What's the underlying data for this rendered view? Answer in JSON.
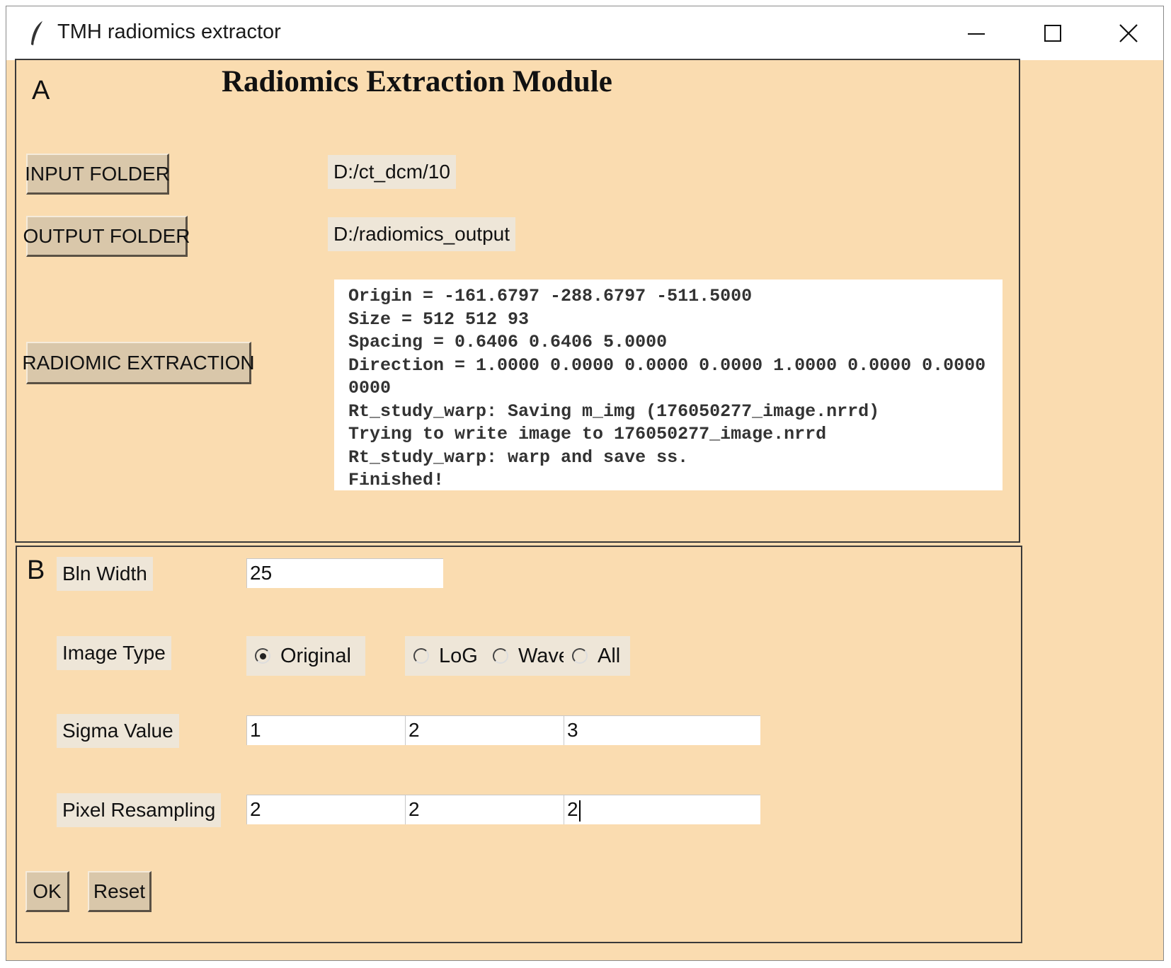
{
  "window": {
    "title": "TMH radiomics extractor",
    "icon": "feather-icon",
    "controls": [
      "minimize-icon",
      "maximize-icon",
      "close-icon"
    ]
  },
  "section_a": {
    "letter": "A",
    "title": "Radiomics Extraction Module",
    "input_folder": {
      "label": "INPUT FOLDER",
      "path": "D:/ct_dcm/10"
    },
    "output_folder": {
      "label": "OUTPUT FOLDER",
      "path": "D:/radiomics_output"
    },
    "radiomic_extraction": {
      "label": "RADIOMIC EXTRACTION"
    },
    "log_lines": [
      "Origin = -161.6797 -288.6797 -511.5000",
      "Size = 512 512 93",
      "Spacing = 0.6406 0.6406 5.0000",
      "Direction = 1.0000 0.0000 0.0000 0.0000 1.0000 0.0000 0.0000",
      "0000",
      "Rt_study_warp: Saving m_img (176050277_image.nrrd)",
      "Trying to write image to 176050277_image.nrrd",
      "Rt_study_warp: warp and save ss.",
      "Finished!"
    ]
  },
  "section_b": {
    "letter": "B",
    "bin_width": {
      "label": "Bln Width",
      "value": "25"
    },
    "image_type": {
      "label": "Image Type",
      "options": [
        {
          "label": "Original",
          "selected": true
        },
        {
          "label": "LoG",
          "selected": false
        },
        {
          "label": "Wave",
          "selected": false
        },
        {
          "label": "All",
          "selected": false
        }
      ]
    },
    "sigma_value": {
      "label": "Sigma Value",
      "values": [
        "1",
        "2",
        "3"
      ]
    },
    "pixel_resampling": {
      "label": "Pixel Resampling",
      "values": [
        "2",
        "2",
        "2"
      ]
    },
    "ok_label": "OK",
    "reset_label": "Reset"
  },
  "colors": {
    "background": "#fadcb0",
    "button_face": "#d9c7aa",
    "label_bg": "#eee6d8"
  }
}
